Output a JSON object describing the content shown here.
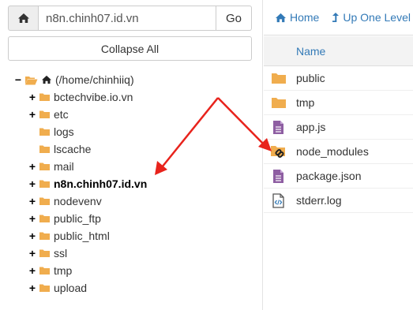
{
  "path_bar": {
    "value": "n8n.chinh07.id.vn",
    "go_label": "Go"
  },
  "collapse_label": "Collapse All",
  "tree": {
    "root_label": "(/home/chinhiiq)",
    "items": [
      {
        "label": "bctechvibe.io.vn",
        "expandable": true,
        "bold": false
      },
      {
        "label": "etc",
        "expandable": true,
        "bold": false
      },
      {
        "label": "logs",
        "expandable": false,
        "bold": false
      },
      {
        "label": "lscache",
        "expandable": false,
        "bold": false
      },
      {
        "label": "mail",
        "expandable": true,
        "bold": false
      },
      {
        "label": "n8n.chinh07.id.vn",
        "expandable": true,
        "bold": true
      },
      {
        "label": "nodevenv",
        "expandable": true,
        "bold": false
      },
      {
        "label": "public_ftp",
        "expandable": true,
        "bold": false
      },
      {
        "label": "public_html",
        "expandable": true,
        "bold": false
      },
      {
        "label": "ssl",
        "expandable": true,
        "bold": false
      },
      {
        "label": "tmp",
        "expandable": true,
        "bold": false
      },
      {
        "label": "upload",
        "expandable": true,
        "bold": false
      }
    ]
  },
  "toolbar": {
    "home_label": "Home",
    "up_label": "Up One Level"
  },
  "files": {
    "header_name": "Name",
    "rows": [
      {
        "name": "public",
        "icon": "folder-icon"
      },
      {
        "name": "tmp",
        "icon": "folder-icon"
      },
      {
        "name": "app.js",
        "icon": "text-file-icon"
      },
      {
        "name": "node_modules",
        "icon": "folder-link-icon"
      },
      {
        "name": "package.json",
        "icon": "text-file-icon"
      },
      {
        "name": "stderr.log",
        "icon": "code-file-icon"
      }
    ]
  },
  "colors": {
    "folder": "#f0ad4e",
    "file": "#8e5ea2",
    "link": "#337ab7",
    "arrow": "#e8231c"
  }
}
